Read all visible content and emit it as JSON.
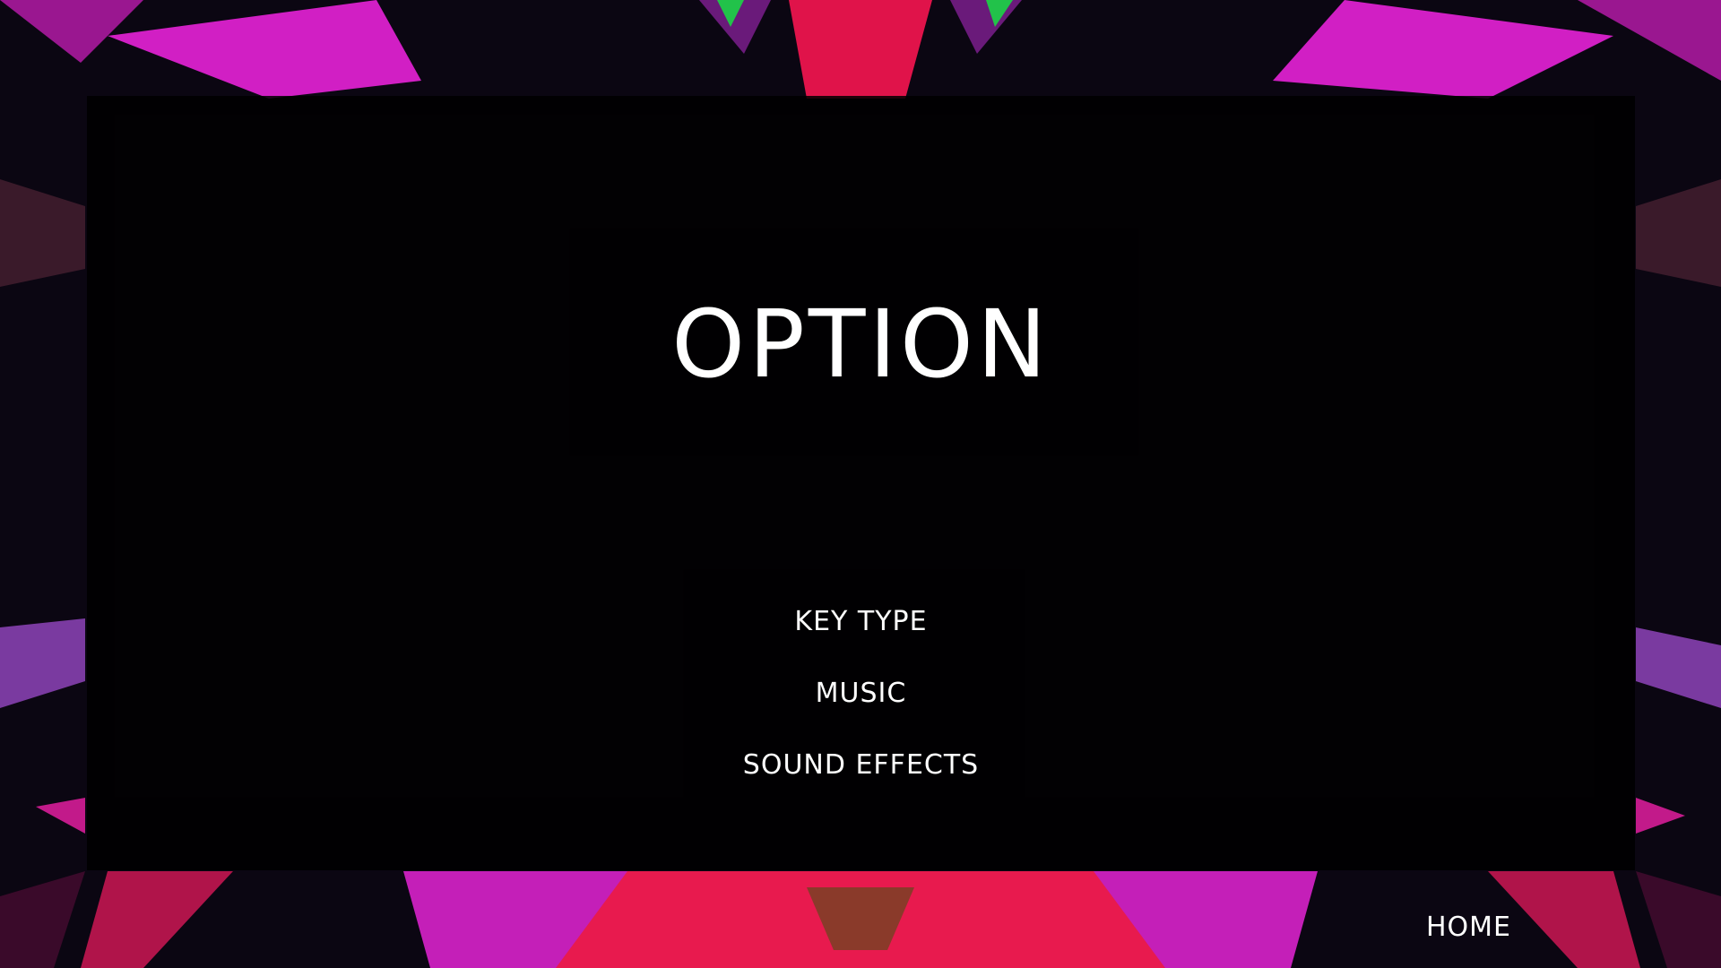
{
  "screen": {
    "title": "OPTION"
  },
  "menu": {
    "items": [
      {
        "label": "KEY TYPE"
      },
      {
        "label": "MUSIC"
      },
      {
        "label": "SOUND EFFECTS"
      }
    ]
  },
  "nav": {
    "home_label": "HOME"
  },
  "colors": {
    "text": "#ffffff",
    "panel": "#000000",
    "accent_magenta": "#d11fc4",
    "accent_red": "#f0194a",
    "accent_purple": "#5a1a6a"
  }
}
